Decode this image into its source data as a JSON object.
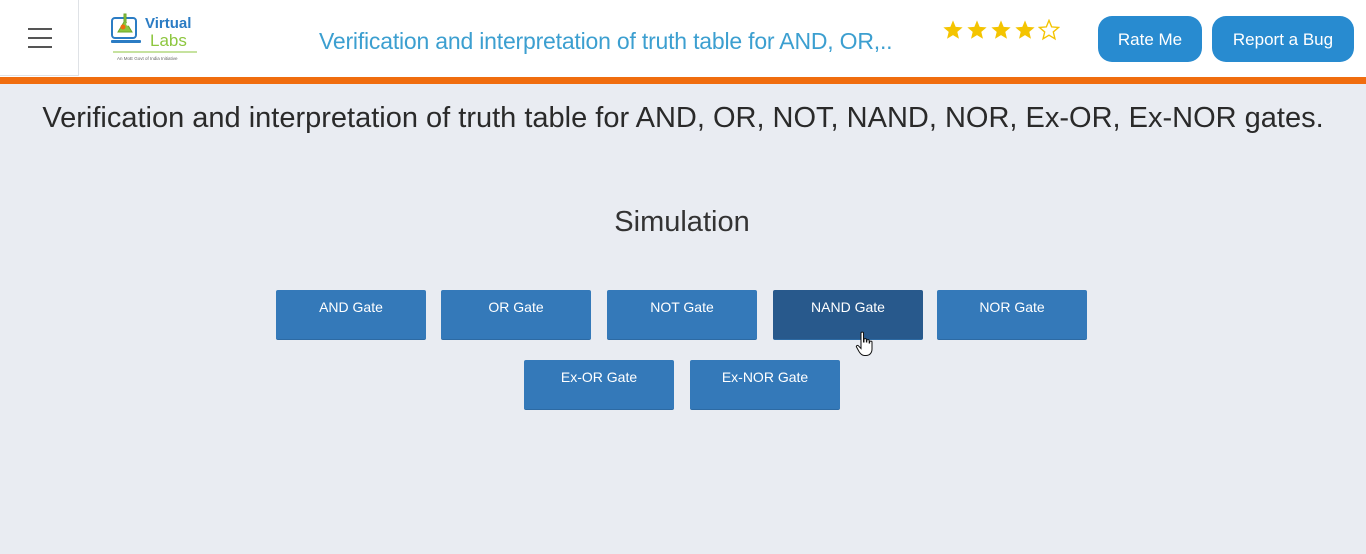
{
  "header": {
    "menu_icon": "hamburger-menu-icon",
    "logo": {
      "line1": "Virtual",
      "line2": "Labs",
      "tagline": "An MoE Govt of India Initiative",
      "colors": {
        "blue": "#2b7cc4",
        "green": "#8dc63f",
        "orange": "#f06d0f"
      }
    },
    "title": "Verification and interpretation of truth table for AND, OR,..",
    "rating": {
      "filled": 4,
      "total": 5,
      "star_color": "#f4c400"
    },
    "rate_label": "Rate Me",
    "bug_label": "Report a Bug"
  },
  "page": {
    "heading": "Verification and interpretation of truth table for AND, OR, NOT, NAND, NOR, Ex-OR, Ex-NOR gates.",
    "section_title": "Simulation"
  },
  "gates": [
    {
      "label": "AND Gate"
    },
    {
      "label": "OR Gate"
    },
    {
      "label": "NOT Gate"
    },
    {
      "label": "NAND Gate",
      "state": "hover"
    },
    {
      "label": "NOR Gate"
    },
    {
      "label": "Ex-OR Gate"
    },
    {
      "label": "Ex-NOR Gate"
    }
  ],
  "cursor": "hand-pointer-icon",
  "colors": {
    "accent_bar": "#f06d0f",
    "header_title": "#3c9fd0",
    "pill_button": "#288bd0",
    "gate_button": "#3479b9",
    "gate_button_hover": "#28598c",
    "background": "#e9ecf2"
  }
}
